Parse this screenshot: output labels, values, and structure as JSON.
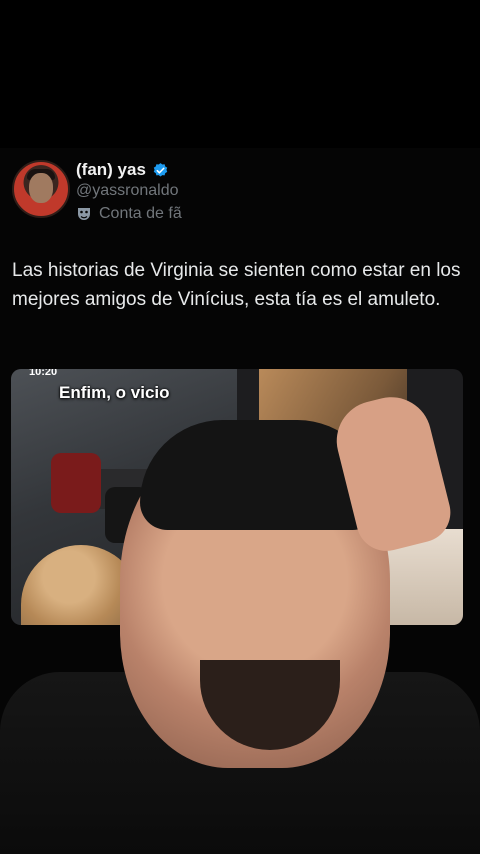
{
  "tweet": {
    "display_name": "(fan) yas",
    "handle": "@yassronaldo",
    "fan_label": "Conta de fã",
    "text": "Las historias de Virginia se sienten como estar en los mejores amigos de Vinícius, esta tía es el amuleto.",
    "verified_color": "#1d9bf0"
  },
  "media": {
    "caption": "Enfim, o vicio",
    "timestamp": "10:20"
  },
  "icons": [
    "verified-icon",
    "mask-icon"
  ]
}
